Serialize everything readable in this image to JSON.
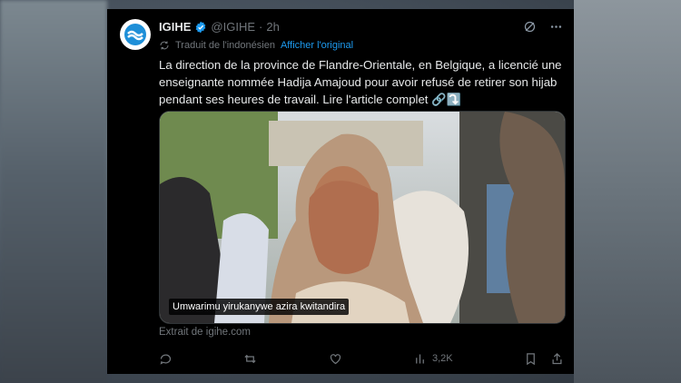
{
  "tweet": {
    "author_name": "IGIHE",
    "handle": "@IGIHE",
    "separator": "·",
    "time": "2h",
    "translation_note": "Traduit de l'indonésien",
    "show_original": "Afficher l'original",
    "text": "La direction de la province de Flandre-Orientale, en Belgique, a licencié une enseignante nommée Hadija Amajoud pour avoir refusé de retirer son hijab pendant ses heures de travail. Lire l'article complet 🔗⤵️",
    "media_caption": "Umwarimu yirukanywe azira kwitandira",
    "extract_from": "Extrait de igihe.com",
    "views": "3,2K"
  },
  "colors": {
    "accent": "#1d9bf0",
    "card_bg": "#000000",
    "muted": "#71767b"
  },
  "icons": {
    "verified": "verified-badge-icon",
    "grok": "grok-icon",
    "more": "more-icon",
    "translate": "translate-icon",
    "reply": "reply-icon",
    "retweet": "retweet-icon",
    "like": "like-icon",
    "views": "views-icon",
    "bookmark": "bookmark-icon",
    "share": "share-icon"
  }
}
